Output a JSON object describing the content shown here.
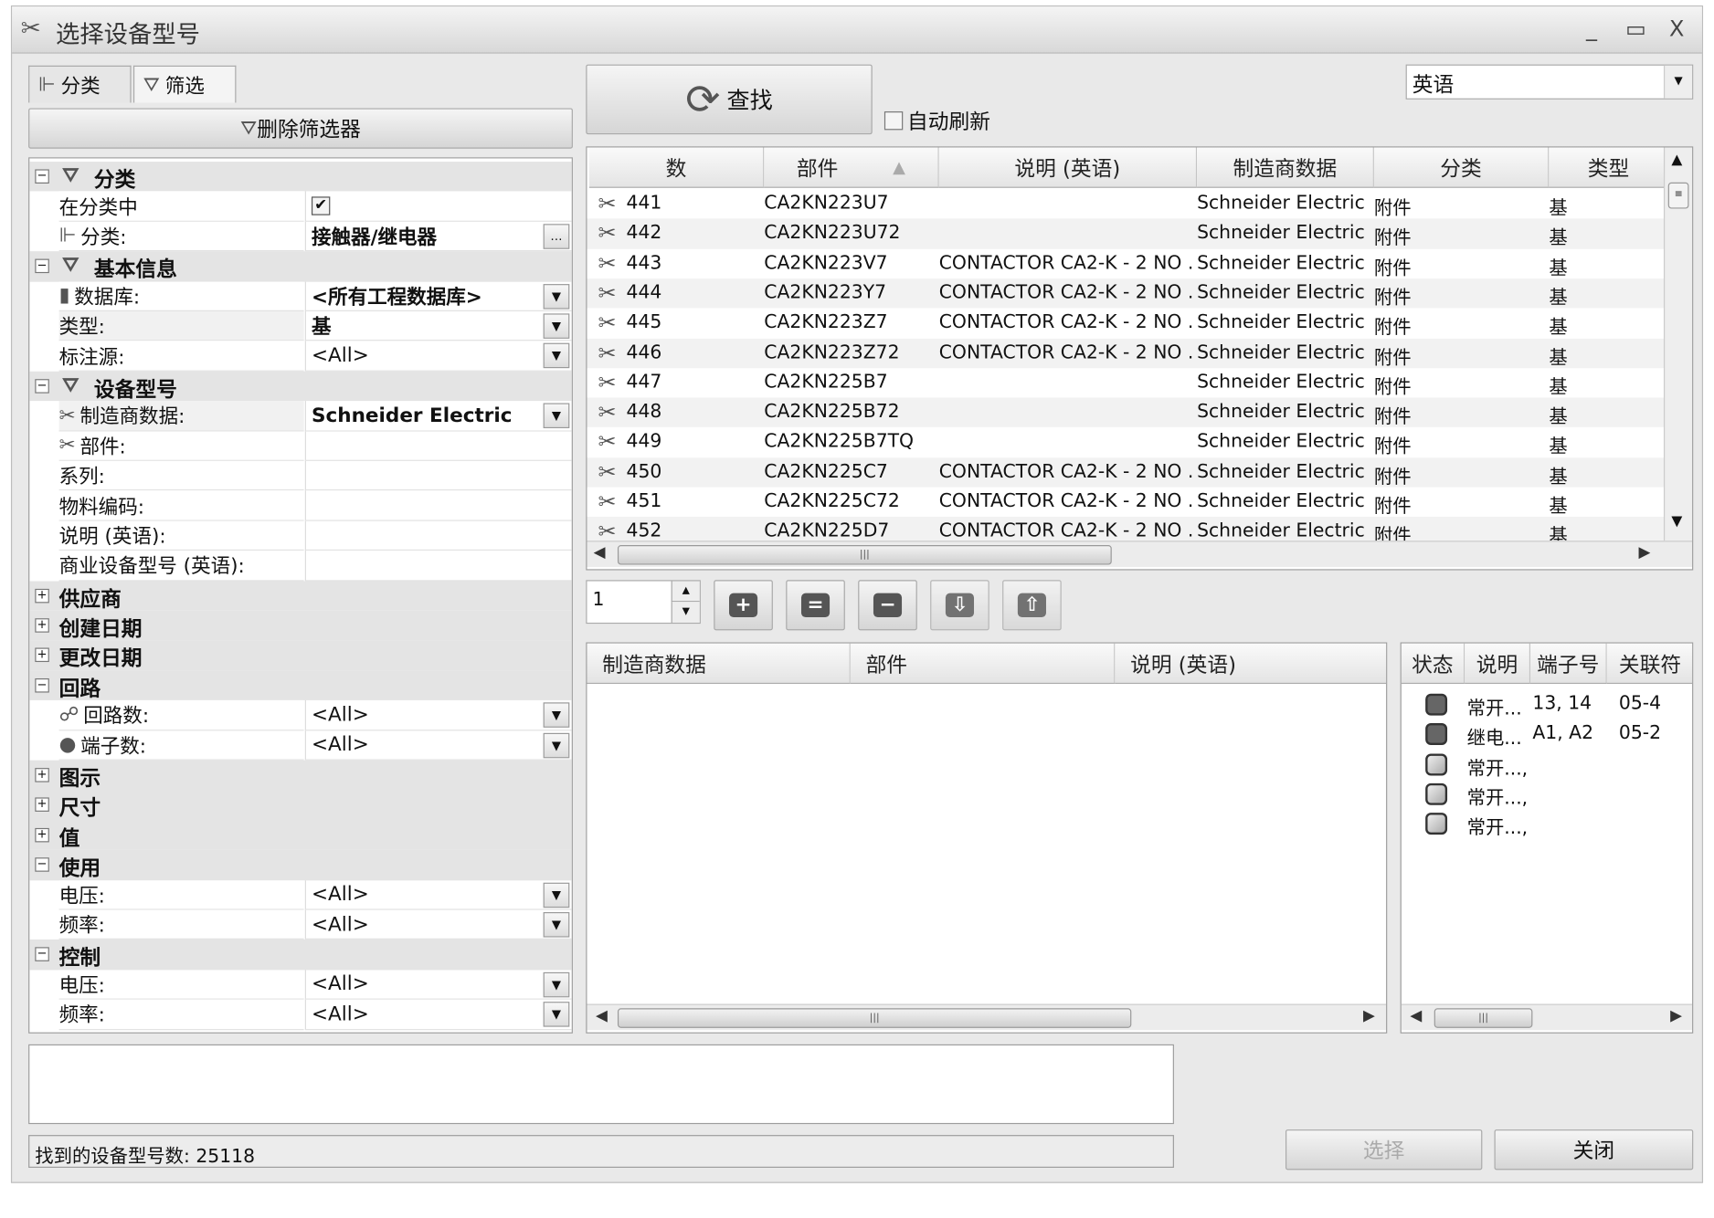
{
  "window": {
    "title": "选择设备型号",
    "minimize": "_",
    "maximize": "▭",
    "close": "X"
  },
  "tabs": [
    {
      "label": "分类",
      "icon": "tree-icon"
    },
    {
      "label": "筛选",
      "icon": "funnel-icon"
    }
  ],
  "delete_filter_label": "删除筛选器",
  "search_label": "查找",
  "auto_refresh_label": "自动刷新",
  "language": {
    "value": "英语"
  },
  "property_grid": [
    {
      "type": "cat",
      "open": true,
      "funnel": true,
      "label": "分类"
    },
    {
      "label": "在分类中",
      "check": true
    },
    {
      "label": "分类:",
      "icon": "tree",
      "value": "接触器/继电器",
      "bold": true,
      "ellipsis": true
    },
    {
      "type": "cat",
      "open": true,
      "funnel": true,
      "label": "基本信息"
    },
    {
      "label": "数据库:",
      "icon": "db",
      "value": "<所有工程数据库>",
      "bold": true,
      "dd": true
    },
    {
      "label": "类型:",
      "value": "基",
      "bold": true,
      "dd": true,
      "alt": true
    },
    {
      "label": "标注源:",
      "value": "<All>",
      "dd": true
    },
    {
      "type": "cat",
      "open": true,
      "funnel": true,
      "label": "设备型号"
    },
    {
      "label": "制造商数据:",
      "icon": "tool",
      "value": "Schneider Electric",
      "bold": true,
      "dd": true,
      "alt": true
    },
    {
      "label": "部件:",
      "icon": "tool"
    },
    {
      "label": "系列:"
    },
    {
      "label": "物料编码:"
    },
    {
      "label": "说明 (英语):"
    },
    {
      "label": "商业设备型号 (英语):"
    },
    {
      "type": "cat",
      "open": false,
      "label": "供应商"
    },
    {
      "type": "cat",
      "open": false,
      "label": "创建日期"
    },
    {
      "type": "cat",
      "open": false,
      "label": "更改日期"
    },
    {
      "type": "cat",
      "open": true,
      "label": "回路"
    },
    {
      "label": "回路数:",
      "icon": "circuit",
      "value": "<All>",
      "dd": true
    },
    {
      "label": "端子数:",
      "icon": "ball",
      "value": "<All>",
      "dd": true
    },
    {
      "type": "cat",
      "open": false,
      "label": "图示"
    },
    {
      "type": "cat",
      "open": false,
      "label": "尺寸"
    },
    {
      "type": "cat",
      "open": false,
      "label": "值"
    },
    {
      "type": "cat",
      "open": true,
      "label": "使用"
    },
    {
      "label": "电压:",
      "value": "<All>",
      "dd": true
    },
    {
      "label": "频率:",
      "value": "<All>",
      "dd": true
    },
    {
      "type": "cat",
      "open": true,
      "label": "控制"
    },
    {
      "label": "电压:",
      "value": "<All>",
      "dd": true
    },
    {
      "label": "频率:",
      "value": "<All>",
      "dd": true
    }
  ],
  "main_table": {
    "columns": [
      "数",
      "部件",
      "说明 (英语)",
      "制造商数据",
      "分类",
      "类型"
    ],
    "sort_indicator": "▲",
    "rows": [
      [
        "441",
        "CA2KN223U7",
        "",
        "Schneider Electric",
        "附件",
        "基"
      ],
      [
        "442",
        "CA2KN223U72",
        "",
        "Schneider Electric",
        "附件",
        "基"
      ],
      [
        "443",
        "CA2KN223V7",
        "CONTACTOR CA2-K - 2 NO ...",
        "Schneider Electric",
        "附件",
        "基"
      ],
      [
        "444",
        "CA2KN223Y7",
        "CONTACTOR CA2-K - 2 NO ...",
        "Schneider Electric",
        "附件",
        "基"
      ],
      [
        "445",
        "CA2KN223Z7",
        "CONTACTOR CA2-K - 2 NO ...",
        "Schneider Electric",
        "附件",
        "基"
      ],
      [
        "446",
        "CA2KN223Z72",
        "CONTACTOR CA2-K - 2 NO ...",
        "Schneider Electric",
        "附件",
        "基"
      ],
      [
        "447",
        "CA2KN225B7",
        "",
        "Schneider Electric",
        "附件",
        "基"
      ],
      [
        "448",
        "CA2KN225B72",
        "",
        "Schneider Electric",
        "附件",
        "基"
      ],
      [
        "449",
        "CA2KN225B7TQ",
        "",
        "Schneider Electric",
        "附件",
        "基"
      ],
      [
        "450",
        "CA2KN225C7",
        "CONTACTOR CA2-K - 2 NO ...",
        "Schneider Electric",
        "附件",
        "基"
      ],
      [
        "451",
        "CA2KN225C72",
        "CONTACTOR CA2-K - 2 NO ...",
        "Schneider Electric",
        "附件",
        "基"
      ],
      [
        "452",
        "CA2KN225D7",
        "CONTACTOR CA2-K - 2 NO ...",
        "Schneider Electric",
        "附件",
        "基"
      ]
    ]
  },
  "stepper_value": "1",
  "toolbar": [
    {
      "name": "add-button",
      "glyph": "+"
    },
    {
      "name": "equal-button",
      "glyph": "="
    },
    {
      "name": "remove-button",
      "glyph": "−"
    },
    {
      "name": "move-down-button",
      "glyph": "⇩"
    },
    {
      "name": "move-up-button",
      "glyph": "⇧"
    }
  ],
  "parts_table": {
    "columns": [
      "制造商数据",
      "部件",
      "说明 (英语)"
    ]
  },
  "functions_table": {
    "columns": [
      "状态",
      "说明",
      "端子号",
      "关联符"
    ],
    "rows": [
      {
        "filled": true,
        "desc": "常开...",
        "terminals": "13, 14",
        "ref": "05-4"
      },
      {
        "filled": true,
        "desc": "继电...",
        "terminals": "A1, A2",
        "ref": "05-2"
      },
      {
        "filled": false,
        "desc": "常开...,",
        "terminals": "",
        "ref": ""
      },
      {
        "filled": false,
        "desc": "常开...,",
        "terminals": "",
        "ref": ""
      },
      {
        "filled": false,
        "desc": "常开...,",
        "terminals": "",
        "ref": ""
      }
    ]
  },
  "status": "找到的设备型号数: 25118",
  "select_label": "选择",
  "close_label": "关闭"
}
